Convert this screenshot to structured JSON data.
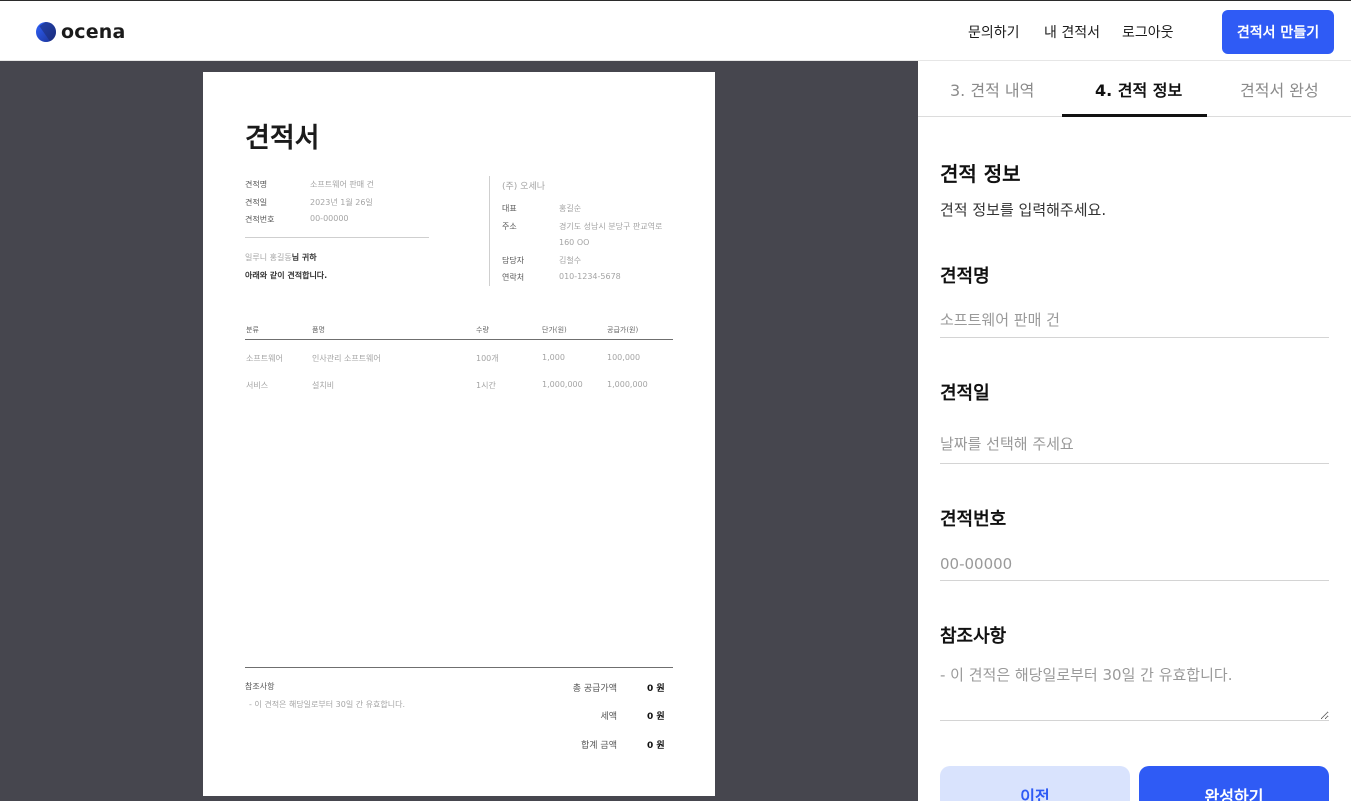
{
  "header": {
    "logo_text": "ocena",
    "nav": [
      "문의하기",
      "내 견적서",
      "로그아웃"
    ],
    "create_button": "견적서 만들기"
  },
  "document": {
    "title": "견적서",
    "fields": [
      {
        "label": "견적명",
        "value": "소프트웨어 판매 건"
      },
      {
        "label": "견적일",
        "value": "2023년 1월 26일"
      },
      {
        "label": "견적번호",
        "value": "00-00000"
      }
    ],
    "greeting_line1_prefix": "일루니 홍길동",
    "greeting_line1_suffix": "님 귀하",
    "greeting_line2": "아래와 같이 견적합니다.",
    "supplier_name": "(주) 오세나",
    "supplier": [
      {
        "label": "대표",
        "value": "홍길순"
      },
      {
        "label": "주소",
        "value": "경기도 성남시 분당구 판교역로",
        "value2": "160 OO"
      },
      {
        "label": "담당자",
        "value": "김철수"
      },
      {
        "label": "연락처",
        "value": "010-1234-5678"
      }
    ],
    "table": {
      "headers": [
        "분류",
        "품명",
        "수량",
        "단가(원)",
        "공급가(원)"
      ],
      "rows": [
        [
          "소프트웨어",
          "인사관리 소프트웨어",
          "100개",
          "1,000",
          "100,000"
        ],
        [
          "서비스",
          "설치비",
          "1시간",
          "1,000,000",
          "1,000,000"
        ]
      ]
    },
    "note_label": "참조사항",
    "note_text": "- 이 견적은 해당일로부터 30일 간 유효합니다.",
    "totals": [
      {
        "label": "총 공급가액",
        "value": "0 원"
      },
      {
        "label": "세액",
        "value": "0 원"
      },
      {
        "label": "합계 금액",
        "value": "0 원"
      }
    ]
  },
  "panel": {
    "tabs": [
      "3. 견적 내역",
      "4. 견적 정보",
      "견적서 완성"
    ],
    "active_tab": "4. 견적 정보",
    "section_title": "견적 정보",
    "section_desc": "견적 정보를 입력해주세요.",
    "fields": {
      "name": {
        "label": "견적명",
        "placeholder": "소프트웨어 판매 건"
      },
      "date": {
        "label": "견적일",
        "placeholder": "날짜를 선택해 주세요"
      },
      "number": {
        "label": "견적번호",
        "placeholder": "00-00000"
      },
      "note": {
        "label": "참조사항",
        "placeholder": "- 이 견적은 해당일로부터 30일 간 유효합니다."
      }
    },
    "prev_button": "이전",
    "done_button": "완성하기"
  },
  "colors": {
    "accent": "#2f5bf5",
    "accent_light": "#d9e3fd",
    "preview_bg": "#46464e"
  }
}
